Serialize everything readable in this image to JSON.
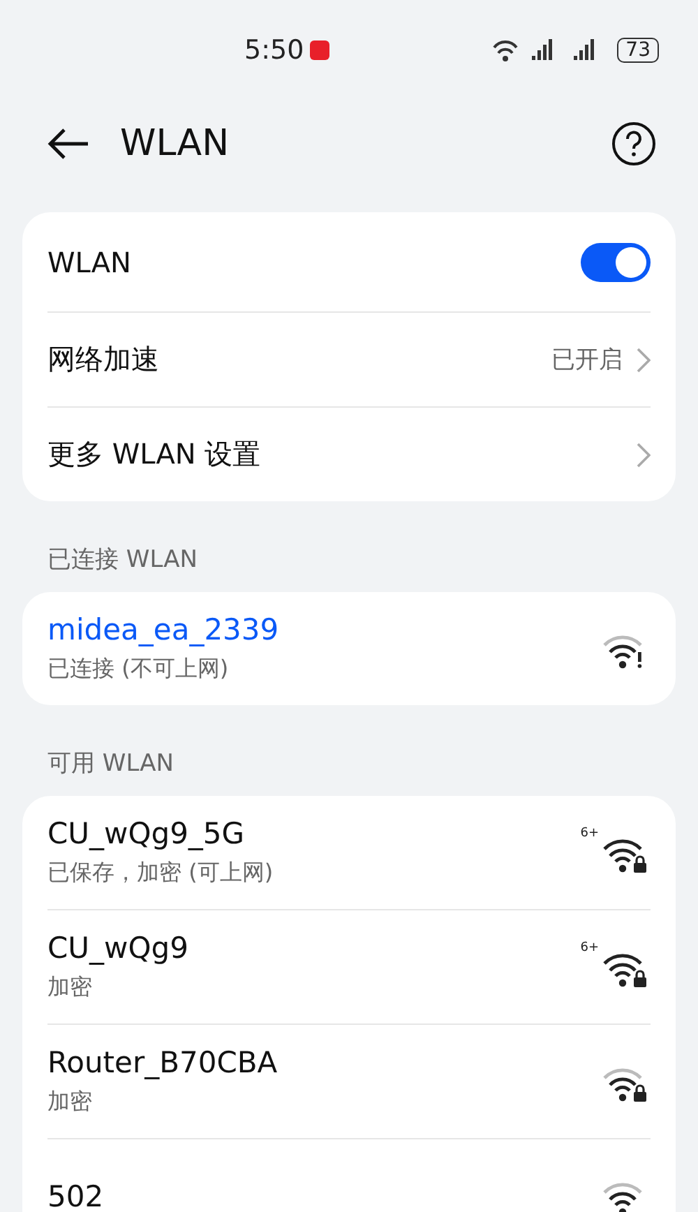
{
  "status_bar": {
    "time": "5:50",
    "battery": "73"
  },
  "header": {
    "title": "WLAN"
  },
  "settings": [
    {
      "kind": "toggle",
      "label": "WLAN",
      "on": true
    },
    {
      "kind": "link",
      "label": "网络加速",
      "value": "已开启"
    },
    {
      "kind": "link",
      "label": "更多 WLAN 设置"
    }
  ],
  "connected": {
    "label": "已连接 WLAN",
    "networks": [
      {
        "name": "midea_ea_2339",
        "status": "已连接 (不可上网)",
        "connected": true,
        "wifi6": false,
        "secure": false,
        "warning": true
      }
    ]
  },
  "available": {
    "label": "可用 WLAN",
    "networks": [
      {
        "name": "CU_wQg9_5G",
        "status": "已保存，加密 (可上网)",
        "badge": "6+",
        "connected": false,
        "wifi6": true,
        "secure": true,
        "warning": false
      },
      {
        "name": "CU_wQg9",
        "status": "加密",
        "badge": "6+",
        "connected": false,
        "wifi6": true,
        "secure": true,
        "warning": false
      },
      {
        "name": "Router_B70CBA",
        "status": "加密",
        "connected": false,
        "wifi6": false,
        "secure": true,
        "warning": false
      },
      {
        "name": "502",
        "connected": false,
        "wifi6": false,
        "secure": false,
        "warning": false
      }
    ]
  }
}
